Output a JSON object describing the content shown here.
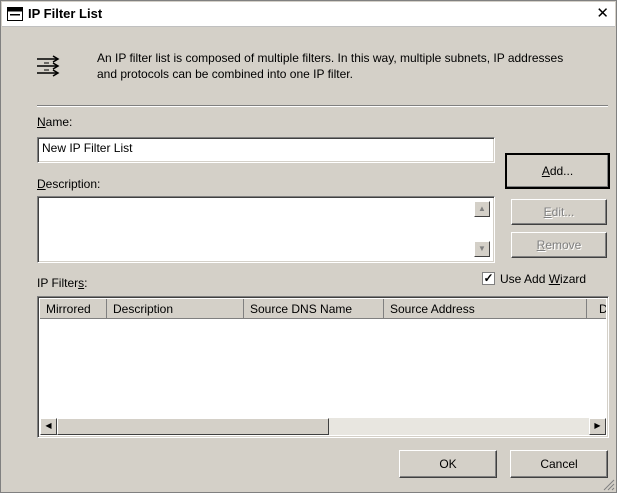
{
  "title": "IP Filter List",
  "close_glyph": "✕",
  "info_text": "An IP filter list is composed of multiple filters. In this way, multiple subnets, IP addresses and protocols can be combined into one IP filter.",
  "name": {
    "label_key": "N",
    "label_rest": "ame:",
    "value": "New IP Filter List"
  },
  "description": {
    "label_key": "D",
    "label_rest": "escription:",
    "value": ""
  },
  "buttons": {
    "add": {
      "key": "A",
      "rest": "dd..."
    },
    "edit": {
      "key": "E",
      "rest": "dit..."
    },
    "remove": {
      "key": "R",
      "rest": "emove"
    },
    "ok": "OK",
    "cancel": "Cancel"
  },
  "filters": {
    "label_pre": "IP Filter",
    "label_key": "s",
    "label_post": ":",
    "columns": [
      "Mirrored",
      "Description",
      "Source DNS Name",
      "Source Address",
      "D"
    ],
    "rows": []
  },
  "use_wizard": {
    "checked": true,
    "label_pre": "Use Add ",
    "label_key": "W",
    "label_post": "izard"
  },
  "icons": {
    "title": "dialog-window-icon",
    "info": "ip-filter-list-icon"
  },
  "colors": {
    "face": "#d4d0c8",
    "shadow": "#808080",
    "disabled_text": "#808080"
  }
}
